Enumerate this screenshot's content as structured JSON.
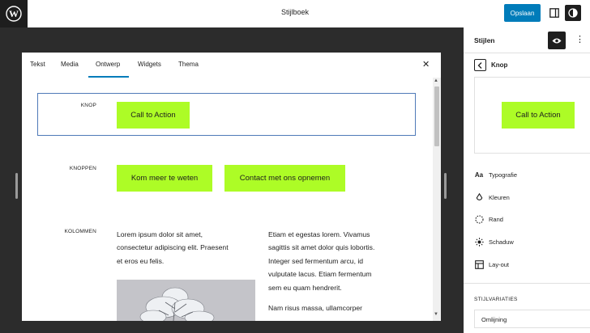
{
  "topbar": {
    "document_title": "Stijlboek",
    "save_label": "Opslaan"
  },
  "stylebook": {
    "tabs": [
      {
        "label": "Tekst"
      },
      {
        "label": "Media"
      },
      {
        "label": "Ontwerp"
      },
      {
        "label": "Widgets"
      },
      {
        "label": "Thema"
      }
    ],
    "active_tab": "Ontwerp",
    "close_symbol": "✕",
    "sections": {
      "knop": {
        "label": "KNOP",
        "button": "Call to Action"
      },
      "knoppen": {
        "label": "KNOPPEN",
        "buttons": [
          "Kom meer te weten",
          "Contact met ons opnemen"
        ]
      },
      "kolommen": {
        "label": "KOLOMMEN",
        "col1": [
          "Lorem ipsum dolor sit amet,",
          "consectetur adipiscing elit. Praesent",
          "et eros eu felis."
        ],
        "col2a": [
          "Etiam et egestas lorem. Vivamus",
          "sagittis sit amet dolor quis lobortis.",
          "Integer sed fermentum arcu, id",
          "vulputate lacus. Etiam fermentum",
          "sem eu quam hendrerit."
        ],
        "col2b": [
          "Nam risus massa, ullamcorper"
        ]
      }
    }
  },
  "sidebar": {
    "title": "Stijlen",
    "panel_title": "Knop",
    "preview_button": "Call to Action",
    "menu": [
      {
        "label": "Typografie",
        "icon": "typography-icon",
        "glyph": "Aa"
      },
      {
        "label": "Kleuren",
        "icon": "droplet-icon"
      },
      {
        "label": "Rand",
        "icon": "border-icon"
      },
      {
        "label": "Schaduw",
        "icon": "shadow-icon"
      },
      {
        "label": "Lay-out",
        "icon": "layout-icon"
      }
    ],
    "variations_heading": "STIJLVARIATIES",
    "variation": "Omlijning"
  },
  "colors": {
    "accent": "#adfc26",
    "primary": "#007cba",
    "dark": "#1e1e1e"
  }
}
